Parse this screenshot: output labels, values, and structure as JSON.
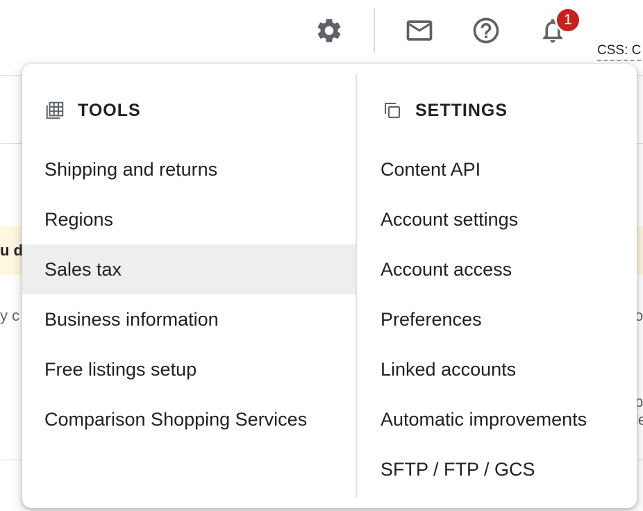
{
  "topbar": {
    "icons": [
      "gear-icon",
      "mail-icon",
      "help-icon",
      "bell-icon"
    ],
    "notification_count": "1",
    "css_label": "CSS: C"
  },
  "background_fragments": {
    "left_1": "u d",
    "left_2": "y c",
    "right_1": "o",
    "right_2": "p",
    "right_3": "le"
  },
  "menu": {
    "tools": {
      "title": "TOOLS",
      "icon": "grid-icon",
      "items": [
        "Shipping and returns",
        "Regions",
        "Sales tax",
        "Business information",
        "Free listings setup",
        "Comparison Shopping Services"
      ],
      "active_index": 2
    },
    "settings": {
      "title": "SETTINGS",
      "icon": "copy-icon",
      "items": [
        "Content API",
        "Account settings",
        "Account access",
        "Preferences",
        "Linked accounts",
        "Automatic improvements",
        "SFTP / FTP / GCS"
      ]
    }
  },
  "colors": {
    "badge": "#c5221f",
    "active_row": "#eeeeee",
    "icon": "#5f6368"
  }
}
